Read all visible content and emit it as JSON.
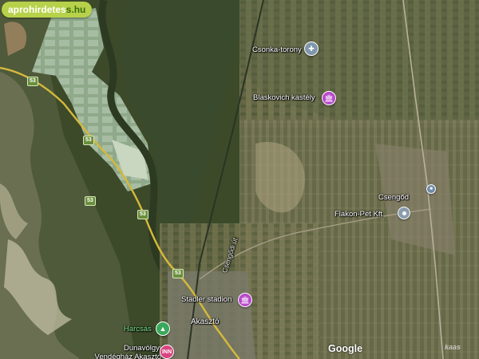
{
  "site_badge": {
    "part1": "aprohirdetes",
    "part2": "s.hu"
  },
  "places": [
    {
      "name": "Csonka-torony",
      "type": "church"
    },
    {
      "name": "Blaskovich kastély",
      "type": "museum"
    },
    {
      "name": "Csengőd",
      "type": "station"
    },
    {
      "name": "Flakon-Pet Kft",
      "type": "business"
    },
    {
      "name": "Stadler stadion",
      "type": "museum"
    },
    {
      "name": "Harcsás",
      "type": "park"
    },
    {
      "name": "Akasztó",
      "type": "town"
    },
    {
      "name": "Dunavölgyi Vendégház Akasztó",
      "type": "lodging"
    }
  ],
  "street": "Csengődi út",
  "road_shields": [
    "53",
    "53",
    "53",
    "53",
    "53"
  ],
  "icons": {
    "church": "cross-icon",
    "museum": "museum-icon",
    "station": "station-icon",
    "business": "location-pin-icon",
    "park": "tree-icon",
    "lodging": "hotel-icon"
  },
  "colors": {
    "badge_bg": "#b7d24a",
    "road": "#d6b93a",
    "museum_pin": "#b84ac9",
    "park_pin": "#3aa85a",
    "lodging_pin": "#d8457f",
    "park_label": "#7fe38c"
  },
  "attribution": "Google",
  "watermark": "kaas"
}
